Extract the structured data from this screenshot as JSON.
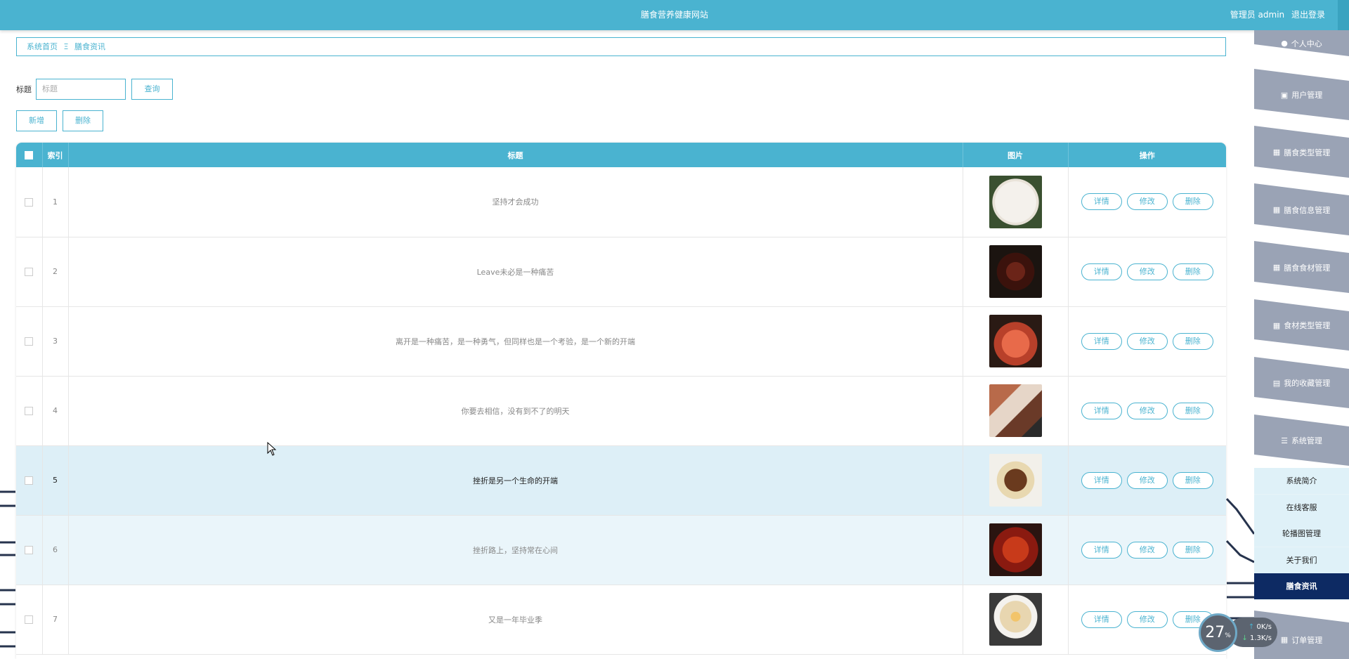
{
  "header": {
    "site_title": "膳食营养健康网站",
    "user_label": "管理员 admin",
    "logout_label": "退出登录"
  },
  "breadcrumb": {
    "home": "系统首页",
    "separator": "Ξ",
    "current": "膳食资讯"
  },
  "search": {
    "label": "标题",
    "placeholder": "标题",
    "value": "",
    "button": "查询"
  },
  "actions": {
    "add": "新增",
    "delete": "删除"
  },
  "table": {
    "headers": {
      "index": "索引",
      "title": "标题",
      "image": "图片",
      "ops": "操作"
    },
    "op_labels": {
      "detail": "详情",
      "edit": "修改",
      "delete": "删除"
    },
    "rows": [
      {
        "index": "1",
        "title": "坚持才会成功",
        "image": "roast-chicken-legs"
      },
      {
        "index": "2",
        "title": "Leave未必是一种痛苦",
        "image": "grilled-sausages"
      },
      {
        "index": "3",
        "title": "离开是一种痛苦，是一种勇气，但同样也是一个考验，是一个新的开端",
        "image": "cooked-shrimp"
      },
      {
        "index": "4",
        "title": "你要去相信，没有到不了的明天",
        "image": "sliced-roast-pork"
      },
      {
        "index": "5",
        "title": "挫折是另一个生命的开端",
        "image": "braised-meat-pot"
      },
      {
        "index": "6",
        "title": "挫折路上，坚持常在心间",
        "image": "spicy-chicken"
      },
      {
        "index": "7",
        "title": "又是一年毕业季",
        "image": "ramen-bowl"
      }
    ]
  },
  "sidebar": {
    "top_items": [
      {
        "label": "个人中心",
        "icon": "person-icon"
      },
      {
        "label": "用户管理",
        "icon": "briefcase-icon"
      },
      {
        "label": "膳食类型管理",
        "icon": "grid-icon"
      },
      {
        "label": "膳食信息管理",
        "icon": "grid-icon"
      },
      {
        "label": "膳食食材管理",
        "icon": "grid-icon"
      },
      {
        "label": "食材类型管理",
        "icon": "grid-icon"
      },
      {
        "label": "我的收藏管理",
        "icon": "trash-icon"
      },
      {
        "label": "系统管理",
        "icon": "list-icon"
      }
    ],
    "sub_items": [
      {
        "label": "系统简介"
      },
      {
        "label": "在线客服"
      },
      {
        "label": "轮播图管理"
      },
      {
        "label": "关于我们"
      },
      {
        "label": "膳食资讯",
        "active": true
      }
    ],
    "bottom_item": {
      "label": "订单管理",
      "icon": "grid-icon"
    }
  },
  "net_widget": {
    "percent": "27",
    "percent_unit": "%",
    "up": "0",
    "up_unit": "K/s",
    "down": "1.3",
    "down_unit": "K/s"
  },
  "colors": {
    "primary": "#4ab3d0",
    "sidebar_bg": "#9aa3b5",
    "active": "#0d2a63",
    "hover_row": "#ddeff7"
  }
}
